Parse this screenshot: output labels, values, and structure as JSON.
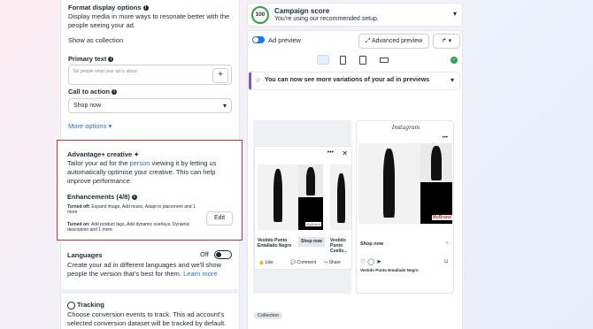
{
  "left": {
    "format": {
      "title": "Format display options",
      "desc": "Display media in more ways to resonate better with the people seeing your ad.",
      "select_value": "Show as collection"
    },
    "primary_text": {
      "label": "Primary text",
      "placeholder": "Tell people what your ad is about",
      "plus": "+"
    },
    "cta": {
      "label": "Call to action",
      "value": "Shop now"
    },
    "more_options": "More options",
    "advantage": {
      "title": "Advantage+ creative",
      "desc_before": "Tailor your ad for the ",
      "desc_link": "person",
      "desc_after": " viewing it by letting us automatically optimise your creative. This can help improve performance.",
      "enh_title": "Enhancements (4/8)",
      "off_label": "Turned off:",
      "off_text": " Expand image, Add music, Adapt to placement and 1 more",
      "on_label": "Turned on:",
      "on_text": " Add product tags, Add dynamic overlays, Dynamic description and 1 more",
      "edit": "Edit"
    },
    "languages": {
      "title": "Languages",
      "toggle": "Off",
      "desc": "Create your ad in different languages and we'll show people the version that's best for them.",
      "learn_more": "Learn more"
    },
    "tracking": {
      "title": "Tracking",
      "desc": "Choose conversion events to track. This ad account's selected conversion dataset will be tracked by default."
    }
  },
  "right": {
    "score": {
      "value": "100",
      "title": "Campaign score",
      "subtitle": "You're using our recommended setup."
    },
    "preview_label": "Ad preview",
    "advanced_preview": "Advanced preview",
    "banner": "You can now see more variations of your ad in previews",
    "collection_tag": "Collection",
    "fb": {
      "title": "Vestido Punto Entallado Negro",
      "shop": "Shop now",
      "like": "Like",
      "comment": "Comment",
      "share": "Share",
      "title2": "Vestido Punto Cuello..."
    },
    "ig": {
      "brand": "Instagram",
      "mybrand": "MyBrand",
      "shop": "Shop now",
      "title": "Vestido Punto Entallado Negro",
      "mybrand_fb": "MyBrand"
    }
  }
}
